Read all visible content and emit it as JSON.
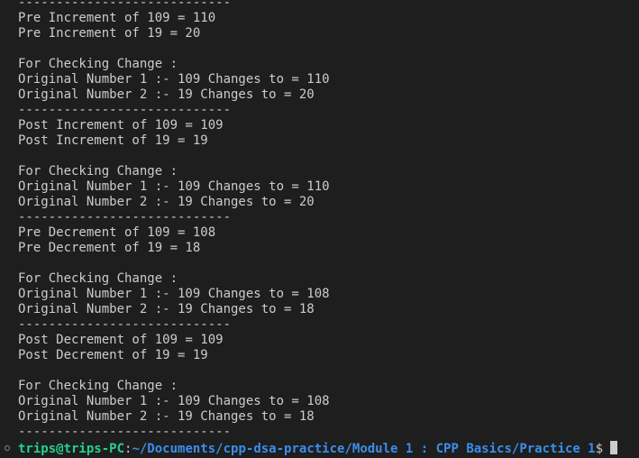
{
  "colors": {
    "background": "#1e1e1e",
    "text": "#cccccc",
    "user": "#23d18b",
    "path": "#3b8eea"
  },
  "output_lines": [
    "----------------------------",
    "Pre Increment of 109 = 110",
    "Pre Increment of 19 = 20",
    "",
    "For Checking Change :",
    "Original Number 1 :- 109 Changes to = 110",
    "Original Number 2 :- 19 Changes to = 20",
    "----------------------------",
    "Post Increment of 109 = 109",
    "Post Increment of 19 = 19",
    "",
    "For Checking Change :",
    "Original Number 1 :- 109 Changes to = 110",
    "Original Number 2 :- 19 Changes to = 20",
    "----------------------------",
    "Pre Decrement of 109 = 108",
    "Pre Decrement of 19 = 18",
    "",
    "For Checking Change :",
    "Original Number 1 :- 109 Changes to = 108",
    "Original Number 2 :- 19 Changes to = 18",
    "----------------------------",
    "Post Decrement of 109 = 109",
    "Post Decrement of 19 = 19",
    "",
    "For Checking Change :",
    "Original Number 1 :- 109 Changes to = 108",
    "Original Number 2 :- 19 Changes to = 18",
    "----------------------------"
  ],
  "prompt": {
    "user_host": "trips@trips-PC",
    "separator": ":",
    "path": "~/Documents/cpp-dsa-practice/Module 1 : CPP Basics/Practice 1",
    "symbol": "$"
  }
}
